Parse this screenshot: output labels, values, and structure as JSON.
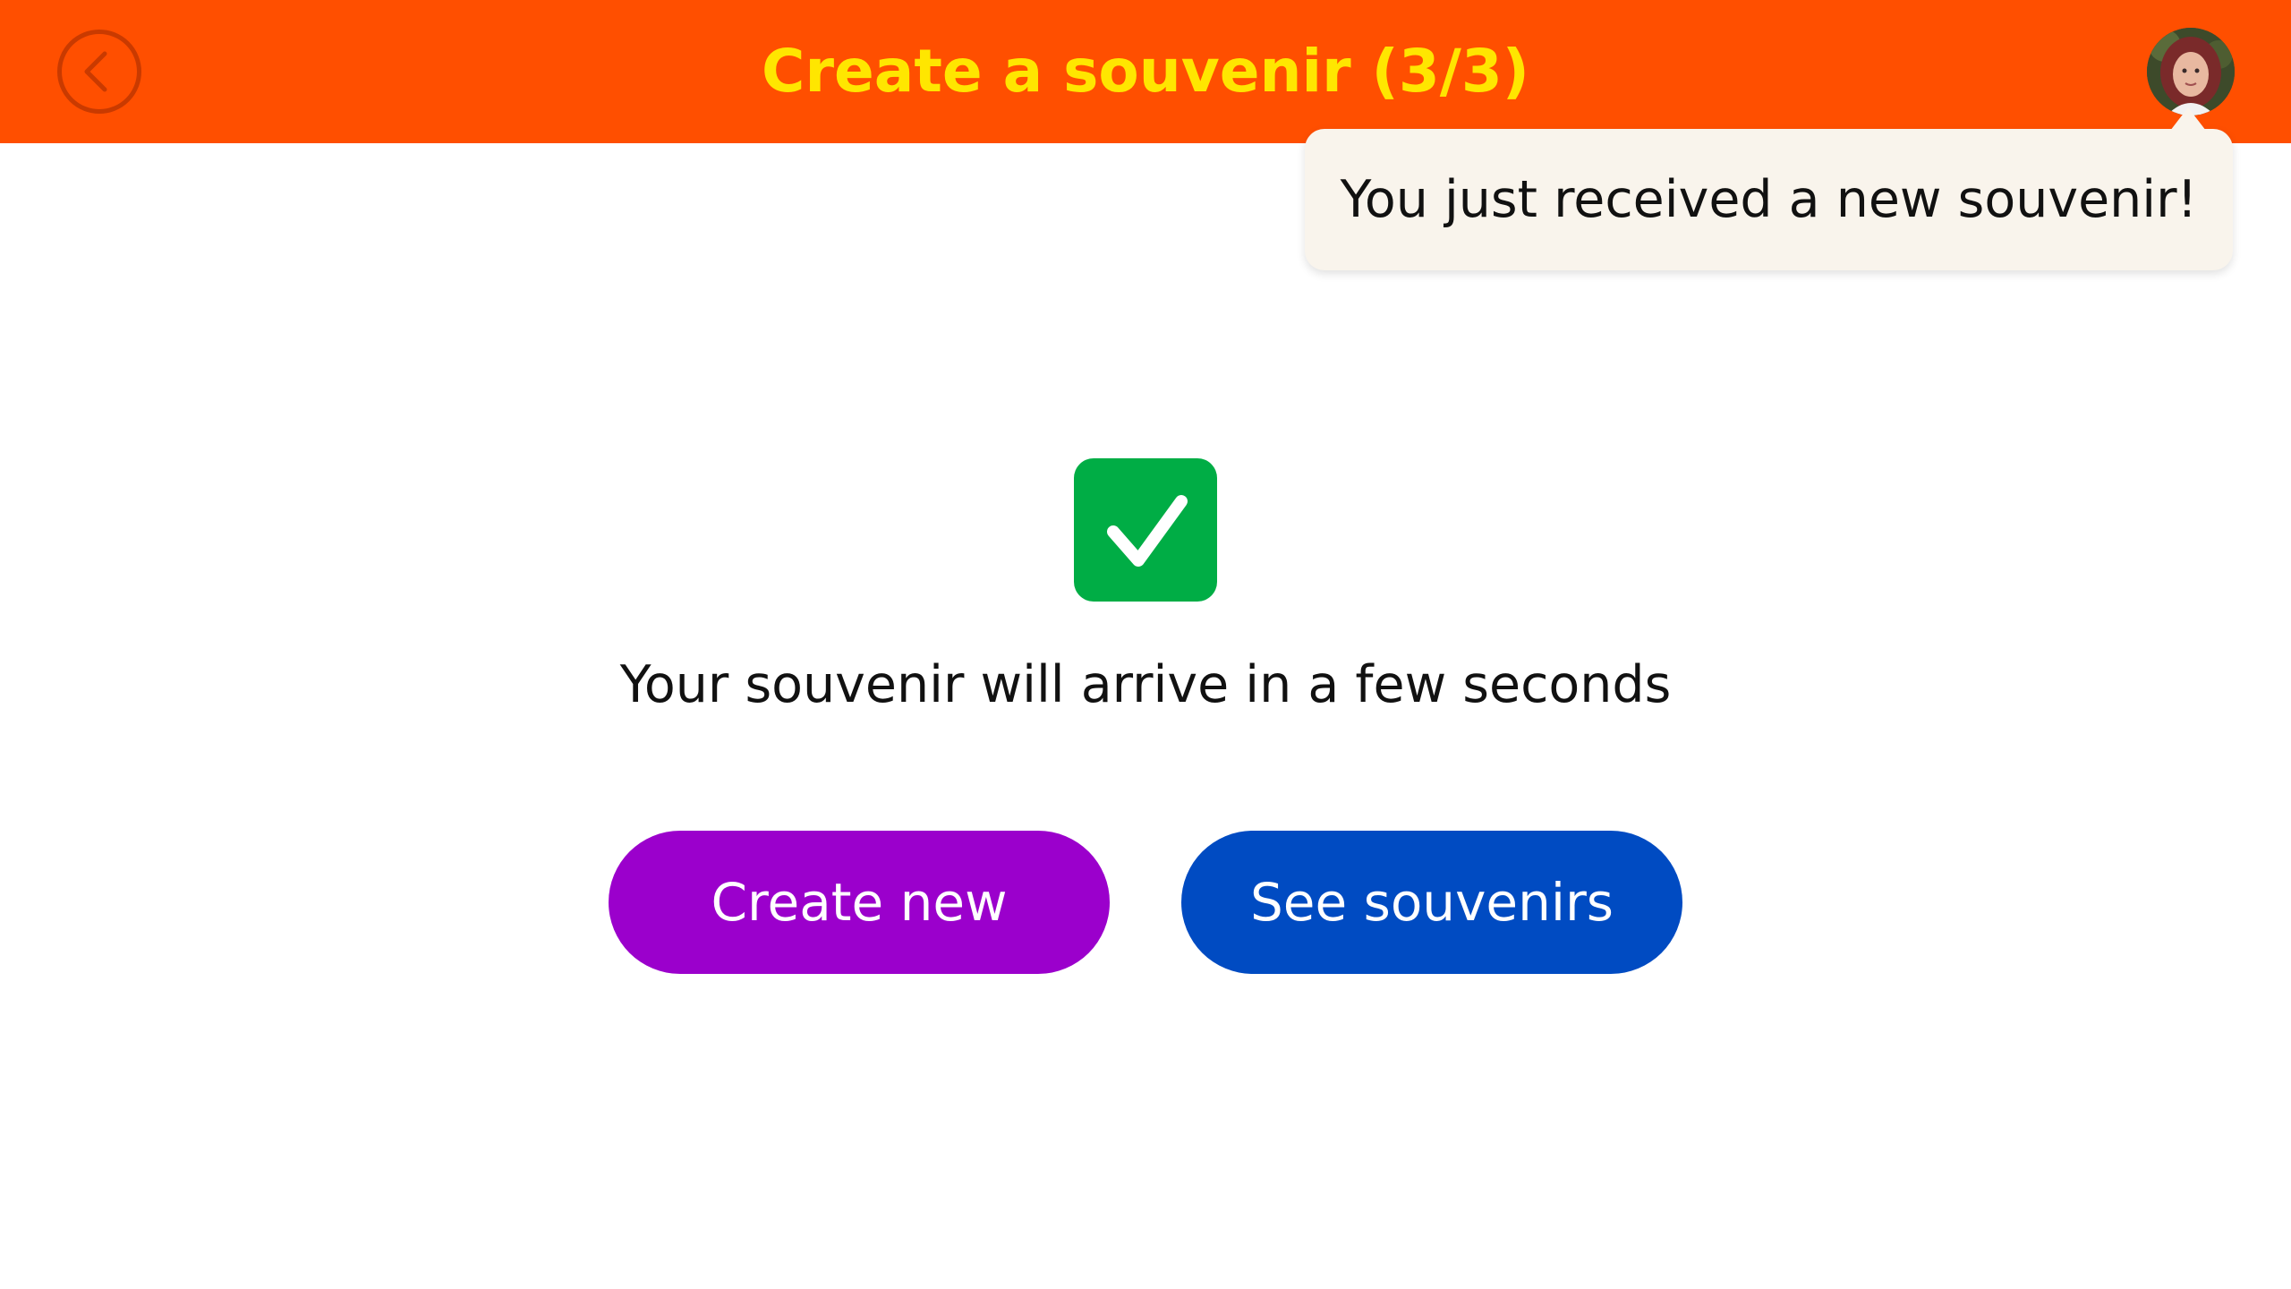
{
  "header": {
    "title": "Create a souvenir (3/3)",
    "back_icon": "chevron-left-icon",
    "avatar_icon": "user-avatar",
    "background_color": "#ff4f00",
    "title_color": "#ffe600"
  },
  "notification": {
    "text": "You just received a new souvenir!",
    "background_color": "#f9f4ec"
  },
  "main": {
    "status_icon": "checkmark-icon",
    "status_color": "#00ad45",
    "message": "Your souvenir will arrive in a few seconds",
    "buttons": [
      {
        "label": "Create new",
        "color": "#9b00cc"
      },
      {
        "label": "See souvenirs",
        "color": "#004bc2"
      }
    ]
  }
}
